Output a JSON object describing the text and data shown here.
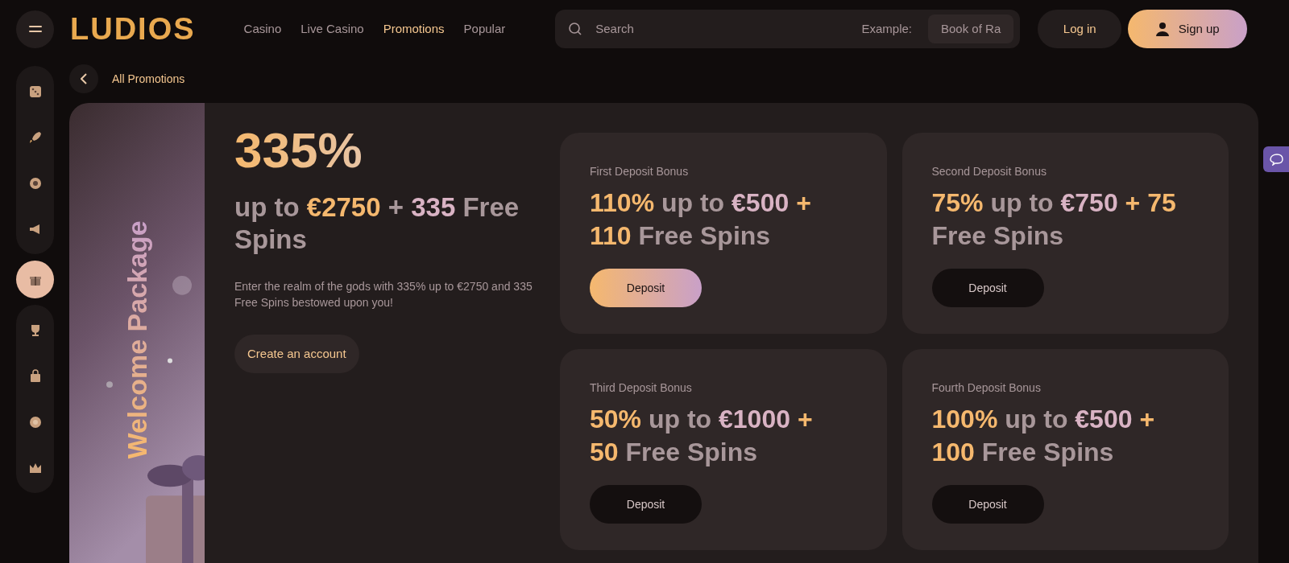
{
  "header": {
    "logo": "LUDIOS",
    "nav": [
      {
        "label": "Casino",
        "selected": false
      },
      {
        "label": "Live Casino",
        "selected": false
      },
      {
        "label": "Promotions",
        "selected": true
      },
      {
        "label": "Popular",
        "selected": false
      }
    ],
    "search": {
      "placeholder": "Search",
      "example_label": "Example:",
      "example": "Book of Ra"
    },
    "login": "Log in",
    "signup": "Sign up"
  },
  "sidebar": {
    "groups": [
      [
        {
          "selected": false
        },
        {
          "selected": false
        },
        {
          "selected": false
        },
        {
          "selected": false
        }
      ],
      [
        {
          "selected": true
        }
      ],
      [
        {
          "selected": false
        },
        {
          "selected": false
        },
        {
          "selected": false
        },
        {
          "selected": false
        }
      ]
    ]
  },
  "breadcrumb": "All Promotions",
  "promo": {
    "banner_title": "Welcome Package",
    "headline": "335%",
    "subheadline": [
      {
        "text": "up to ",
        "color": "#a8979a"
      },
      {
        "text": "€2750",
        "color": "#f5b86e"
      },
      {
        "text": " + ",
        "color": "#a8979a"
      },
      {
        "text": "335",
        "color": "#d9b3c4"
      },
      {
        "text": " Free Spins",
        "color": "#a8979a"
      }
    ],
    "description": "Enter the realm of the gods with 335% up to €2750 and 335 Free Spins bestowed upon you!",
    "cta": "Create an account"
  },
  "bonuses": [
    {
      "label": "First Deposit Bonus",
      "title": [
        {
          "text": "110%",
          "color": "#f5b86e"
        },
        {
          "text": " up to ",
          "color": "#a8979a"
        },
        {
          "text": "€500",
          "color": "#d9b3c4"
        },
        {
          "text": " + 110",
          "color": "#f5b86e"
        },
        {
          "text": " Free Spins",
          "color": "#a8979a"
        }
      ],
      "button": "Deposit",
      "highlighted": true
    },
    {
      "label": "Second Deposit Bonus",
      "title": [
        {
          "text": "75%",
          "color": "#f5b86e"
        },
        {
          "text": " up to ",
          "color": "#a8979a"
        },
        {
          "text": "€750",
          "color": "#d9b3c4"
        },
        {
          "text": " + 75",
          "color": "#f5b86e"
        },
        {
          "text": " Free Spins",
          "color": "#a8979a"
        }
      ],
      "button": "Deposit",
      "highlighted": false
    },
    {
      "label": "Third Deposit Bonus",
      "title": [
        {
          "text": "50%",
          "color": "#f5b86e"
        },
        {
          "text": " up to ",
          "color": "#a8979a"
        },
        {
          "text": "€1000",
          "color": "#d9b3c4"
        },
        {
          "text": " + 50",
          "color": "#f5b86e"
        },
        {
          "text": " Free Spins",
          "color": "#a8979a"
        }
      ],
      "button": "Deposit",
      "highlighted": false
    },
    {
      "label": "Fourth Deposit Bonus",
      "title": [
        {
          "text": "100%",
          "color": "#f5b86e"
        },
        {
          "text": " up to ",
          "color": "#a8979a"
        },
        {
          "text": "€500",
          "color": "#d9b3c4"
        },
        {
          "text": " + 100",
          "color": "#f5b86e"
        },
        {
          "text": " Free Spins",
          "color": "#a8979a"
        }
      ],
      "button": "Deposit",
      "highlighted": false
    }
  ]
}
